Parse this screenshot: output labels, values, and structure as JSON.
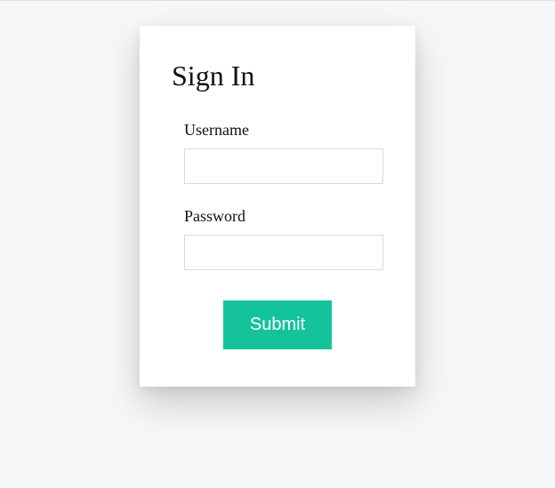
{
  "form": {
    "title": "Sign In",
    "username": {
      "label": "Username",
      "value": ""
    },
    "password": {
      "label": "Password",
      "value": ""
    },
    "submit_label": "Submit"
  },
  "colors": {
    "accent": "#15c39a",
    "background": "#f6f7f9",
    "card": "#ffffff",
    "border": "#d9d9d9"
  }
}
